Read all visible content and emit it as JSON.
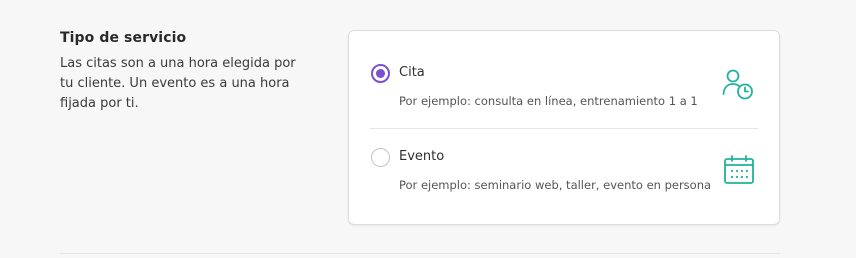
{
  "section": {
    "title": "Tipo de servicio",
    "description": "Las citas son a una hora elegida por tu cliente. Un evento es a una hora fijada por ti."
  },
  "options": [
    {
      "label": "Cita",
      "description": "Por ejemplo: consulta en línea, entrenamiento 1 a 1",
      "selected": true,
      "icon": "person-clock-icon"
    },
    {
      "label": "Evento",
      "description": "Por ejemplo: seminario web, taller, evento en persona",
      "selected": false,
      "icon": "calendar-icon"
    }
  ],
  "colors": {
    "accent": "#7a4fd1",
    "icon": "#1fb39a",
    "background": "#f7f7f7"
  }
}
